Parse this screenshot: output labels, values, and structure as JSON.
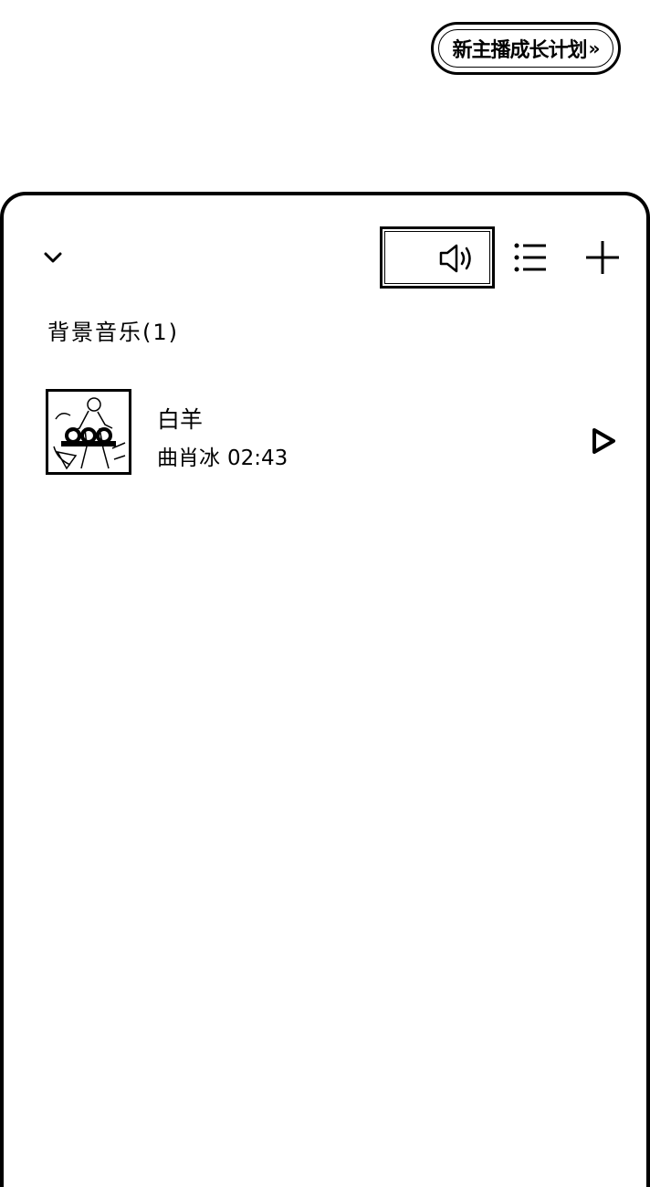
{
  "header": {
    "growth_plan_label": "新主播成长计划",
    "growth_plan_arrow": "»"
  },
  "panel": {
    "section_title": "背景音乐(1)",
    "tracks": [
      {
        "title": "白羊",
        "artist": "曲肖冰",
        "duration": "02:43",
        "cover_icon": "album-cover-guitarist"
      }
    ]
  },
  "icons": {
    "collapse": "chevron-down-icon",
    "volume": "speaker-icon",
    "list": "list-icon",
    "add": "plus-icon",
    "play": "play-icon"
  }
}
